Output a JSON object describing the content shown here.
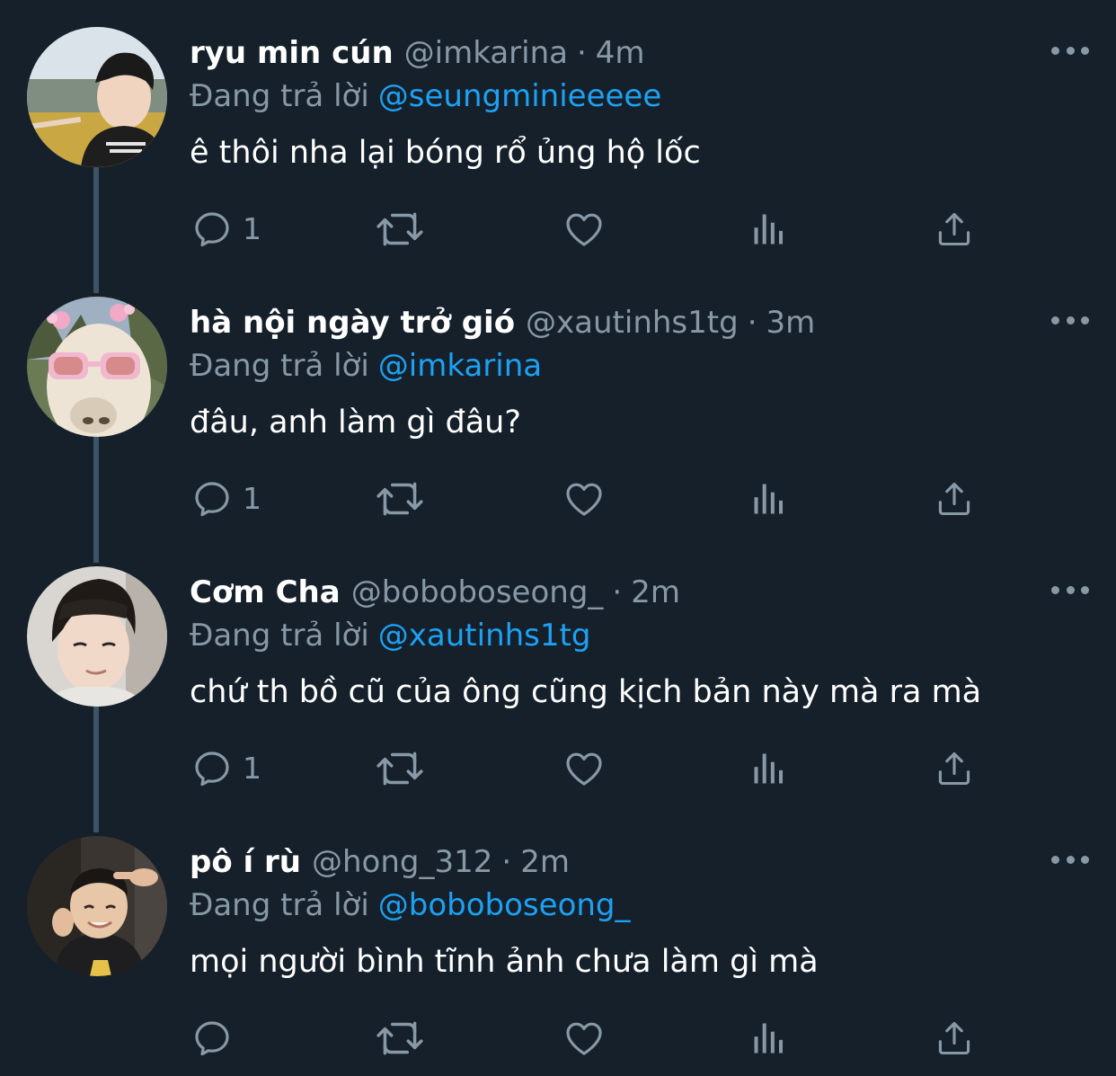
{
  "theme": {
    "background": "#15202b",
    "text_primary": "#ffffff",
    "text_secondary": "#8899a6",
    "link": "#1da1f2",
    "thread_line": "#3d5466"
  },
  "tweets": [
    {
      "name": "ryu min cún",
      "handle": "@imkarina",
      "separator": "·",
      "time": "4m",
      "reply_prefix": "Đang trả lời",
      "reply_to": "@seungminieeeee",
      "text": "ê thôi nha lại bóng rổ ủng hộ lốc",
      "reply_count": "1",
      "icons": [
        "reply-icon",
        "retweet-icon",
        "like-icon",
        "analytics-icon",
        "share-icon",
        "more-icon"
      ]
    },
    {
      "name": "hà nội ngày trở gió",
      "handle": "@xautinhs1tg",
      "separator": "·",
      "time": "3m",
      "reply_prefix": "Đang trả lời",
      "reply_to": "@imkarina",
      "text": "đâu, anh làm gì đâu?",
      "reply_count": "1",
      "icons": [
        "reply-icon",
        "retweet-icon",
        "like-icon",
        "analytics-icon",
        "share-icon",
        "more-icon"
      ]
    },
    {
      "name": "Cơm Cha",
      "handle": "@boboboseong_",
      "separator": "·",
      "time": "2m",
      "reply_prefix": "Đang trả lời",
      "reply_to": "@xautinhs1tg",
      "text": "chứ th bồ cũ của ông cũng kịch bản này mà ra mà",
      "reply_count": "1",
      "icons": [
        "reply-icon",
        "retweet-icon",
        "like-icon",
        "analytics-icon",
        "share-icon",
        "more-icon"
      ]
    },
    {
      "name": "pô í rù",
      "handle": "@hong_312",
      "separator": "·",
      "time": "2m",
      "reply_prefix": "Đang trả lời",
      "reply_to": "@boboboseong_",
      "text": "mọi người bình tĩnh ảnh chưa làm gì mà",
      "reply_count": "",
      "icons": [
        "reply-icon",
        "retweet-icon",
        "like-icon",
        "analytics-icon",
        "share-icon",
        "more-icon"
      ]
    }
  ]
}
